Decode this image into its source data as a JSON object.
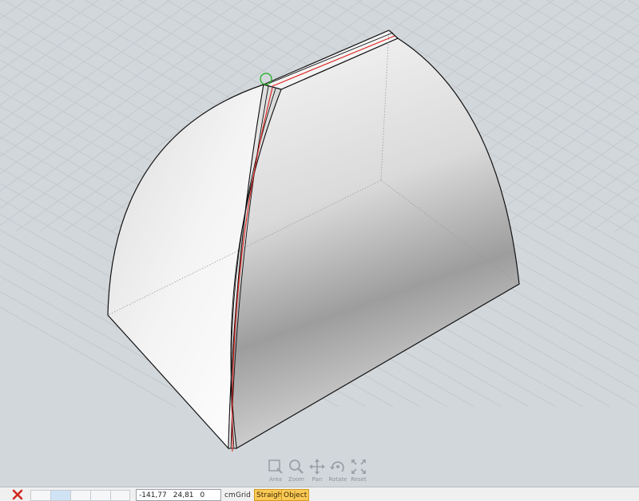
{
  "navigation_tools": [
    {
      "id": "area",
      "label": "Area",
      "icon": "area-zoom-icon"
    },
    {
      "id": "zoom",
      "label": "Zoom",
      "icon": "magnifier-icon"
    },
    {
      "id": "pan",
      "label": "Pan",
      "icon": "pan-arrows-icon"
    },
    {
      "id": "rotate",
      "label": "Rotate",
      "icon": "rotate-icon"
    },
    {
      "id": "reset",
      "label": "Reset",
      "icon": "reset-view-icon"
    }
  ],
  "statusbar": {
    "close_icon": "close-x-icon",
    "coordinates": {
      "x": "-141,77",
      "y": "24,81",
      "z": "0"
    },
    "unit": "cm",
    "grid_label": "Grid",
    "straight_label": "Straight",
    "object_label": "Object"
  },
  "colors": {
    "background": "#d2d7db",
    "grid_line": "#c4c9ce",
    "selected_edge": "#e0201c",
    "snap_marker": "#20b020",
    "toggle_active": "#fbc956",
    "close_icon": "#d0281e"
  }
}
